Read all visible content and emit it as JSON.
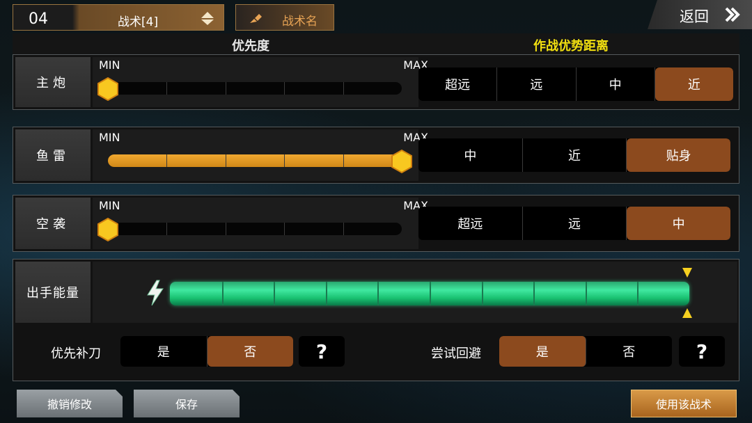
{
  "top": {
    "tactic_number": "04",
    "tactic_select_label": "战术[4]",
    "rename_label": "战术名",
    "back_label": "返回"
  },
  "header": {
    "priority_title": "优先度",
    "range_title": "作战优势距离"
  },
  "weapons": [
    {
      "label": "主炮",
      "min_label": "MIN",
      "max_label": "MAX",
      "priority_fraction": 0.0,
      "ranges": [
        "超远",
        "远",
        "中",
        "近"
      ],
      "selected_range": "近"
    },
    {
      "label": "鱼雷",
      "min_label": "MIN",
      "max_label": "MAX",
      "priority_fraction": 1.0,
      "ranges": [
        "中",
        "近",
        "贴身"
      ],
      "selected_range": "贴身"
    },
    {
      "label": "空袭",
      "min_label": "MIN",
      "max_label": "MAX",
      "priority_fraction": 0.0,
      "ranges": [
        "超远",
        "远",
        "中"
      ],
      "selected_range": "中"
    }
  ],
  "energy": {
    "label": "出手能量",
    "level_fraction": 1.0,
    "segments": 10
  },
  "toggles": {
    "finish_off": {
      "label": "优先补刀",
      "yes": "是",
      "no": "否",
      "selected": "否",
      "help": "?"
    },
    "try_evade": {
      "label": "尝试回避",
      "yes": "是",
      "no": "否",
      "selected": "是",
      "help": "?"
    }
  },
  "bottom": {
    "undo_label": "撤销修改",
    "save_label": "保存",
    "use_label": "使用该战术"
  },
  "colors": {
    "accent_orange": "#8c4a1e",
    "slider_fill": "#f0a830",
    "energy_green": "#40e8a0",
    "range_title": "#f2e010"
  }
}
